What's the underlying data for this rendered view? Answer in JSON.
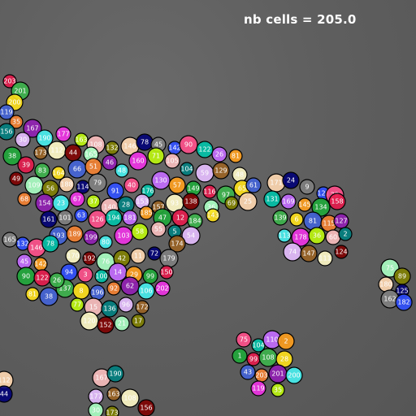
{
  "overlay": {
    "count_text": "nb cells = 205.0"
  },
  "palette": [
    "#e6194b",
    "#3cb44b",
    "#ffe119",
    "#4363d8",
    "#f58231",
    "#911eb4",
    "#46f0f0",
    "#f032e6",
    "#bcf60c",
    "#fabebe",
    "#008080",
    "#e6beff",
    "#9a6324",
    "#fffac8",
    "#800000",
    "#aaffc3",
    "#808000",
    "#ffd8b1",
    "#000075",
    "#808080",
    "#2f4fff",
    "#ff4f8b",
    "#00c2a8",
    "#c46bff",
    "#ff9f1c",
    "#1fa83a"
  ],
  "labels": [
    "203",
    "201",
    "200",
    "119",
    "35",
    "167",
    "190",
    "177",
    "163",
    "108",
    "156",
    "30",
    "173",
    "112",
    "44",
    "165",
    "132",
    "146",
    "78",
    "45",
    "142",
    "90",
    "122",
    "26",
    "81",
    "38",
    "39",
    "83",
    "164",
    "66",
    "51",
    "46",
    "48",
    "160",
    "71",
    "105",
    "104",
    "59",
    "129",
    "48",
    "49",
    "109",
    "56",
    "188",
    "114",
    "79",
    "91",
    "40",
    "176",
    "130",
    "57",
    "149",
    "116",
    "97",
    "65",
    "61",
    "68",
    "154",
    "23",
    "67",
    "37",
    "140",
    "28",
    "153",
    "157",
    "93",
    "138",
    "36",
    "69",
    "25",
    "161",
    "101",
    "63",
    "126",
    "194",
    "181",
    "185",
    "47",
    "12",
    "184",
    "143",
    "193",
    "189",
    "199",
    "80",
    "103",
    "58",
    "55",
    "5",
    "54",
    "174",
    "170",
    "192",
    "76",
    "42",
    "11",
    "72",
    "179",
    "94",
    "3",
    "100",
    "14",
    "29",
    "99",
    "150",
    "137",
    "8",
    "196",
    "92",
    "62",
    "106",
    "202",
    "77",
    "15",
    "136",
    "96",
    "172",
    "120",
    "152",
    "21",
    "17",
    "171",
    "24",
    "9",
    "121",
    "22",
    "131",
    "169",
    "145",
    "134",
    "158",
    "139",
    "6",
    "81",
    "115",
    "127",
    "113",
    "178",
    "36",
    "60",
    "2",
    "74",
    "147",
    "111",
    "124",
    "75",
    "89",
    "180",
    "125",
    "162",
    "182",
    "75",
    "104",
    "110",
    "2",
    "1",
    "99",
    "108",
    "28",
    "43"
  ]
}
